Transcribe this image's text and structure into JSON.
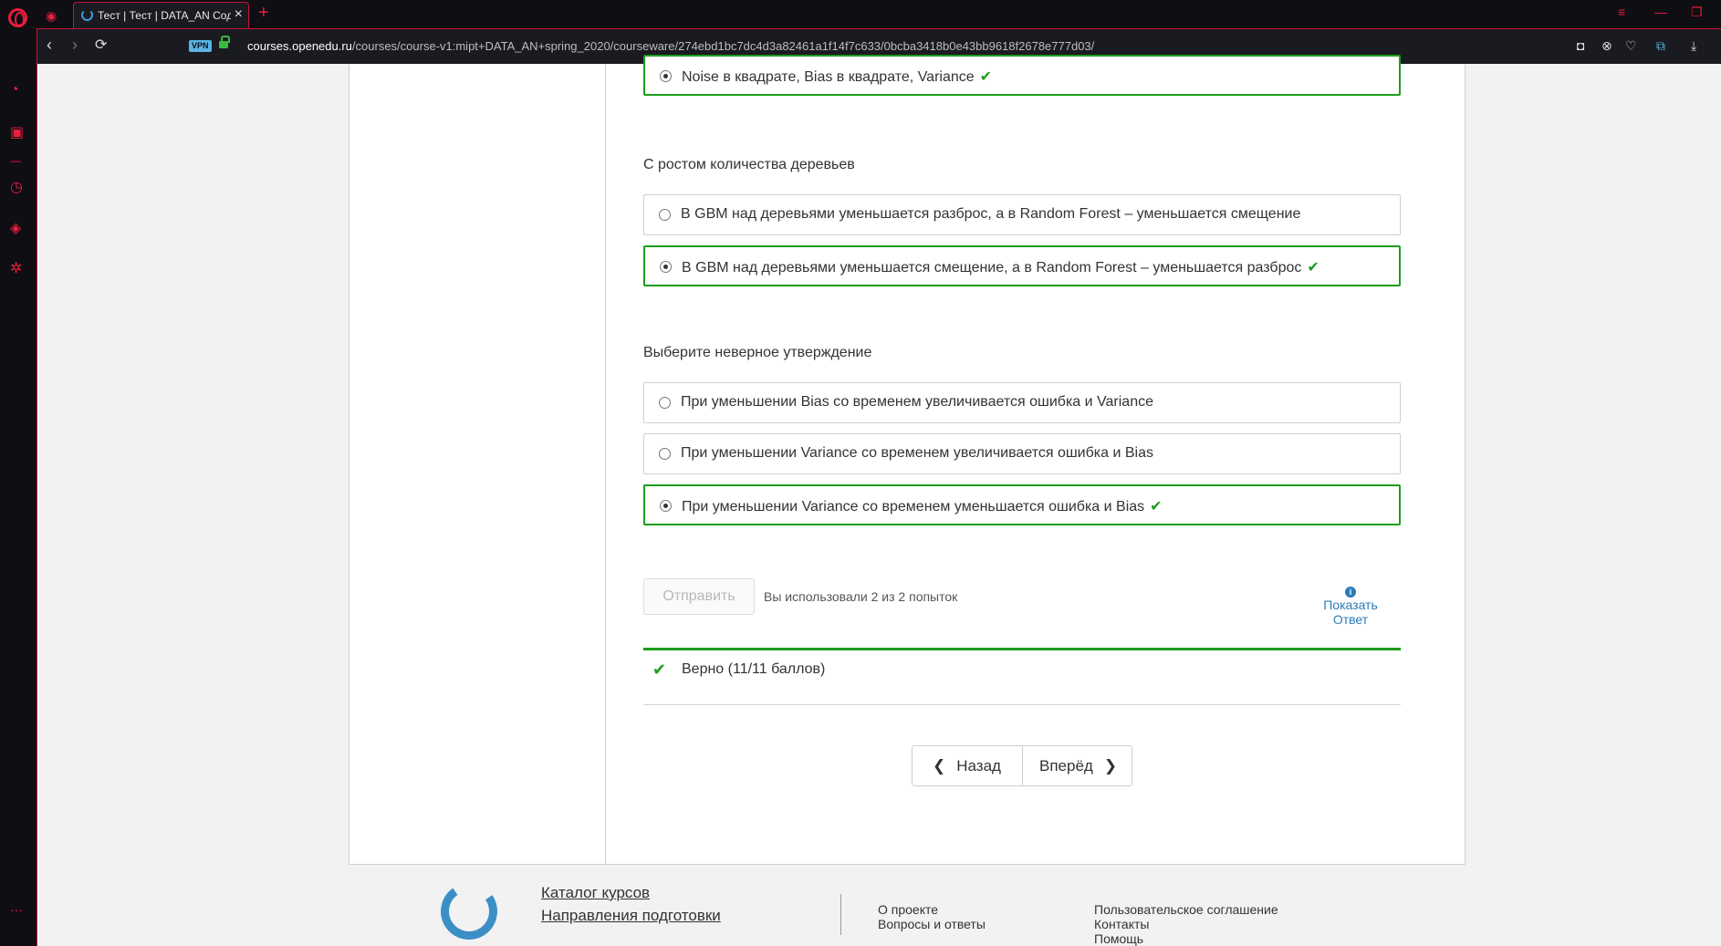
{
  "browser": {
    "tab_title": "Тест | Тест | DATA_AN Сод",
    "vpn_badge": "VPN",
    "url_host": "courses.openedu.ru",
    "url_path": "/courses/course-v1:mipt+DATA_AN+spring_2020/courseware/274ebd1bc7dc4d3a82461a1f14f7c633/0bcba3418b0e43bb9618f2678e777d03/",
    "accent_color": "#e81e3c"
  },
  "problem": {
    "q1_selected": "Noise в квадрате, Bias в квадрате, Variance",
    "q2": {
      "title": "С ростом количества деревьев",
      "options": [
        "В GBM над деревьями уменьшается разброс, а в Random Forest – уменьшается смещение",
        "В GBM над деревьями уменьшается смещение, а в Random Forest – уменьшается разброс"
      ]
    },
    "q3": {
      "title": "Выберите неверное утверждение",
      "options": [
        "При уменьшении Bias со временем увеличивается ошибка и Variance",
        "При уменьшении Variance со временем увеличивается ошибка и Bias",
        "При уменьшении Variance со временем уменьшается ошибка и Bias"
      ]
    },
    "submit_label": "Отправить",
    "attempts_text": "Вы использовали 2 из 2 попыток",
    "show_answer_line1": "Показать",
    "show_answer_line2": "Ответ",
    "status_text": "Верно (11/11 баллов)",
    "correct_color": "#1c9d1c"
  },
  "navigation": {
    "back_label": "Назад",
    "next_label": "Вперёд"
  },
  "footer": {
    "catalog": "Каталог курсов",
    "directions": "Направления подготовки",
    "about": "О проекте",
    "faq": "Вопросы и ответы",
    "agreement": "Пользовательское соглашение",
    "contacts": "Контакты",
    "help": "Помощь"
  }
}
